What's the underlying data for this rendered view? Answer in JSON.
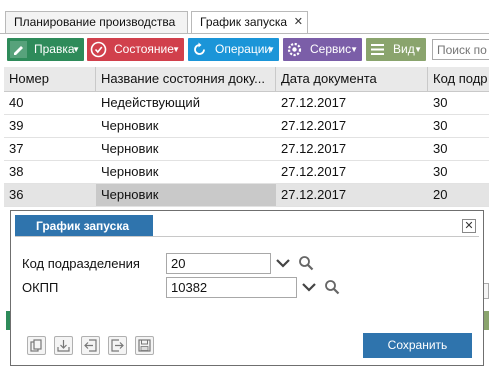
{
  "tabs": [
    {
      "label": "Планирование производства"
    },
    {
      "label": "График запуска",
      "close": "✕"
    }
  ],
  "toolbar": {
    "edit": "Правка",
    "state": "Состояние",
    "ops": "Операции",
    "service": "Сервис",
    "view": "Вид",
    "search_placeholder": "Поиск по п"
  },
  "table": {
    "headers": [
      "Номер",
      "Название состояния доку...",
      "Дата документа",
      "Код подр"
    ],
    "rows": [
      [
        "40",
        "Недействующий",
        "27.12.2017",
        "30"
      ],
      [
        "39",
        "Черновик",
        "27.12.2017",
        "30"
      ],
      [
        "37",
        "Черновик",
        "27.12.2017",
        "30"
      ],
      [
        "38",
        "Черновик",
        "27.12.2017",
        "30"
      ],
      [
        "36",
        "Черновик",
        "27.12.2017",
        "20"
      ]
    ]
  },
  "dialog": {
    "title": "График запуска",
    "close": "✕",
    "fields": [
      {
        "label": "Код подразделения",
        "value": "20"
      },
      {
        "label": "ОКПП",
        "value": "10382"
      }
    ],
    "save": "Сохранить"
  },
  "colors": {
    "edit": "#2e8b5a",
    "state": "#d1404c",
    "ops": "#1b95d8",
    "service": "#7b5ea8",
    "view": "#8aa46d",
    "accent": "#2f74ad"
  }
}
